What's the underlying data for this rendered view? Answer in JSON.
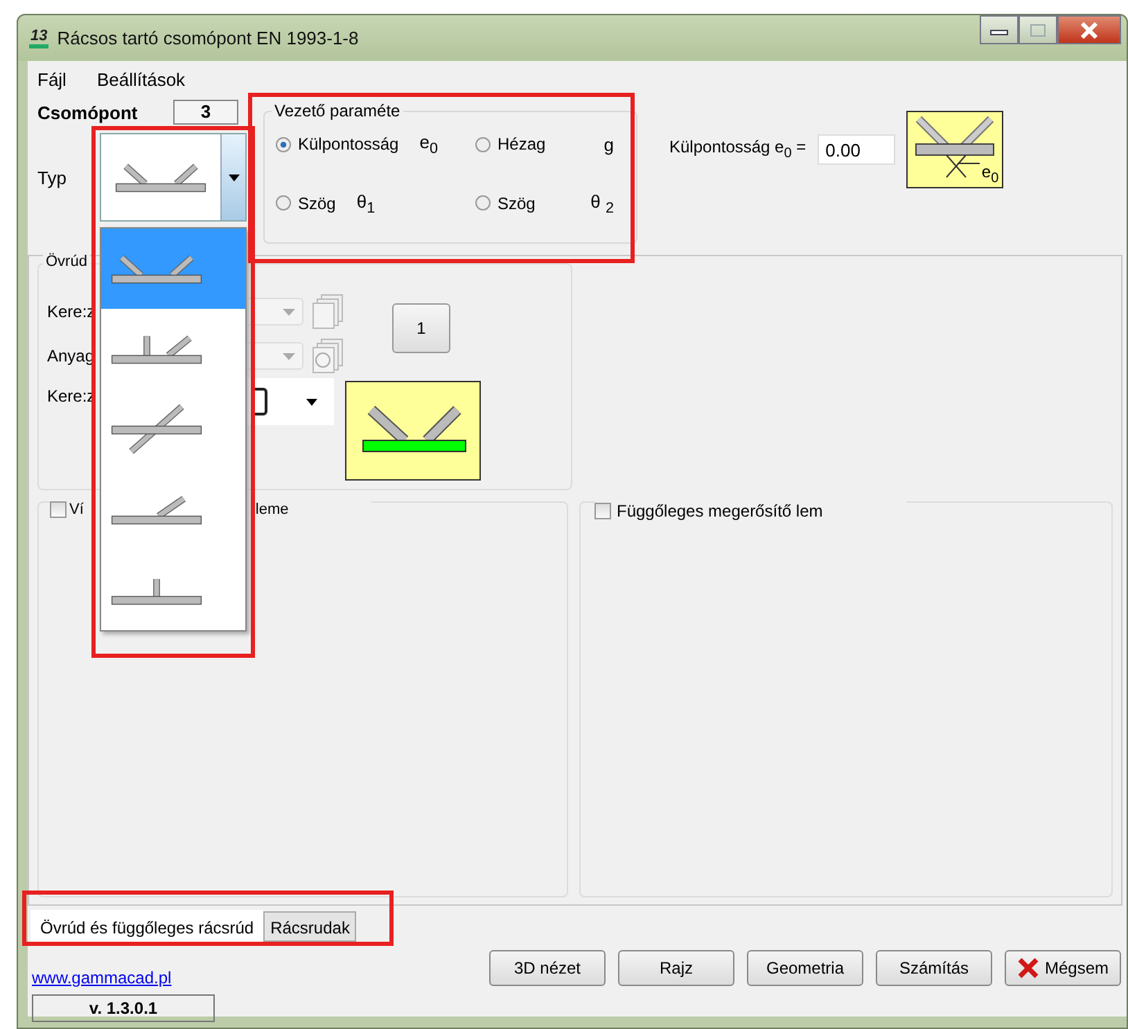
{
  "window": {
    "title": "Rácsos tartó csomópont EN 1993-1-8",
    "icon_text": "13"
  },
  "menu": [
    "Fájl",
    "Beállítások"
  ],
  "node": {
    "label": "Csomópont",
    "value": "3"
  },
  "joint_type": {
    "label": "Typ",
    "expanded": true,
    "options": [
      {
        "kind": "k",
        "selected": true
      },
      {
        "kind": "ky",
        "selected": false
      },
      {
        "kind": "x",
        "selected": false
      },
      {
        "kind": "y",
        "selected": false
      },
      {
        "kind": "t",
        "selected": false
      }
    ]
  },
  "leading_param": {
    "title": "Vezető paraméte",
    "options": [
      {
        "label": "Külpontosság",
        "symbol": "e$_{0}$",
        "selected": true
      },
      {
        "label": "Hézag",
        "symbol": "g",
        "selected": false
      },
      {
        "label": "Szög",
        "symbol": "θ$_{1}$",
        "selected": false
      },
      {
        "label": "Szög",
        "symbol": "θ $_{2}$",
        "selected": false
      }
    ]
  },
  "eccentricity": {
    "label": "Külpontosság e$_{0}$ =",
    "value": "0.00",
    "diagram_label": "e$_{0}$"
  },
  "chord_group": {
    "title": "Övrúd",
    "count_button": "1",
    "rows": [
      {
        "label": "Kere:z",
        "kind": "disabled-combo"
      },
      {
        "label": "Anyag",
        "kind": "disabled-combo"
      },
      {
        "label": "Kere:z",
        "kind": "section-combo"
      }
    ]
  },
  "plates": [
    {
      "label_start": "Ví",
      "label_end": "leme",
      "checked": false
    },
    {
      "label_start": "Függőleges megerősítő lem",
      "checked": false
    }
  ],
  "tabs": [
    {
      "label": "Övrúd és függőleges rácsrúd",
      "selected": true
    },
    {
      "label": "Rácsrudak",
      "selected": false
    }
  ],
  "link": "www.gammacad.pl",
  "version": "v. 1.3.0.1",
  "buttons": [
    {
      "label": "3D nézet",
      "kind": "plain"
    },
    {
      "label": "Rajz",
      "kind": "plain"
    },
    {
      "label": "Geometria",
      "kind": "plain"
    },
    {
      "label": "Számítás",
      "kind": "plain"
    },
    {
      "label": "Mégsem",
      "kind": "cancel"
    }
  ]
}
